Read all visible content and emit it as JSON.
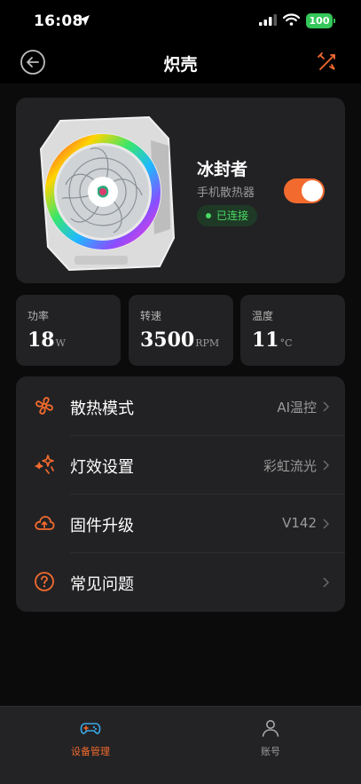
{
  "status": {
    "time": "16:08",
    "battery": "100"
  },
  "nav": {
    "title": "炽壳"
  },
  "device": {
    "name": "冰封者",
    "type": "手机散热器",
    "connection": "已连接",
    "power_on": true
  },
  "stats": [
    {
      "label": "功率",
      "value": "18",
      "unit": "W"
    },
    {
      "label": "转速",
      "value": "3500",
      "unit": "RPM"
    },
    {
      "label": "温度",
      "value": "11",
      "unit": "°C"
    }
  ],
  "menu": [
    {
      "label": "散热模式",
      "value": "AI温控",
      "icon": "fan-icon"
    },
    {
      "label": "灯效设置",
      "value": "彩虹流光",
      "icon": "sparkle-icon"
    },
    {
      "label": "固件升级",
      "value": "V142",
      "icon": "cloud-upload-icon"
    },
    {
      "label": "常见问题",
      "value": "",
      "icon": "question-icon"
    }
  ],
  "tabs": [
    {
      "label": "设备管理",
      "icon": "gamepad-icon",
      "active": true
    },
    {
      "label": "账号",
      "icon": "person-icon",
      "active": false
    }
  ],
  "colors": {
    "accent": "#f26a2e",
    "connected": "#4cd964",
    "tab_active": "#f26a2e",
    "tab_inactive": "#9a9a9a"
  }
}
